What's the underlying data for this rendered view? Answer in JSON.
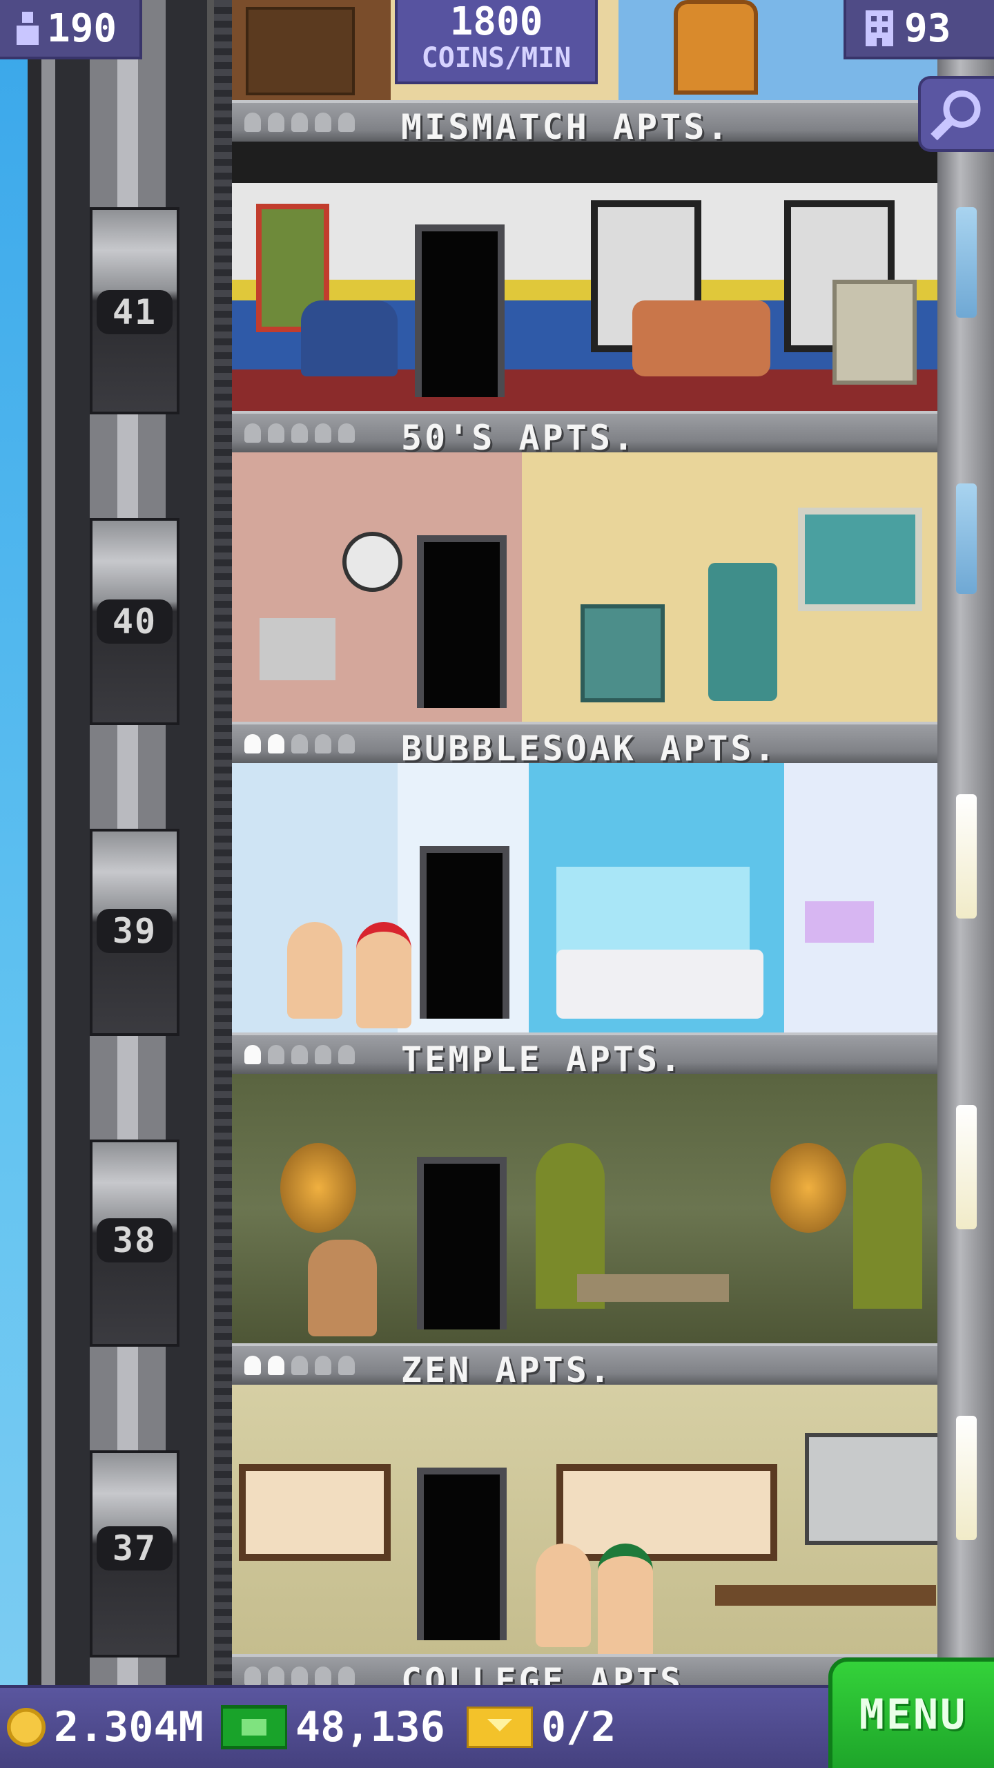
{
  "top_bar": {
    "population": "190",
    "coins_rate": "1800",
    "coins_rate_unit": "COINS/MIN",
    "floors_count": "93"
  },
  "floors": [
    {
      "name": "MISMATCH APTS.",
      "floor_number": "41",
      "occupancy": 0
    },
    {
      "name": "50'S APTS.",
      "floor_number": "40",
      "occupancy": 0
    },
    {
      "name": "BUBBLESOAK APTS.",
      "floor_number": "39",
      "occupancy": 2
    },
    {
      "name": "TEMPLE APTS.",
      "floor_number": "38",
      "occupancy": 1
    },
    {
      "name": "ZEN APTS.",
      "floor_number": "37",
      "occupancy": 2
    },
    {
      "name": "COLLEGE APTS.",
      "floor_number": "",
      "occupancy": 0
    }
  ],
  "occupancy_max": 5,
  "bottom_bar": {
    "coins": "2.304M",
    "bux": "48,136",
    "tickets": "0/2",
    "menu_label": "MENU"
  },
  "colors": {
    "menu_green": "#28b82f",
    "bar_purple": "#4f4b86"
  },
  "icons": [
    "person-icon",
    "building-icon",
    "search-icon",
    "coin-icon",
    "bux-icon",
    "ticket-icon"
  ]
}
